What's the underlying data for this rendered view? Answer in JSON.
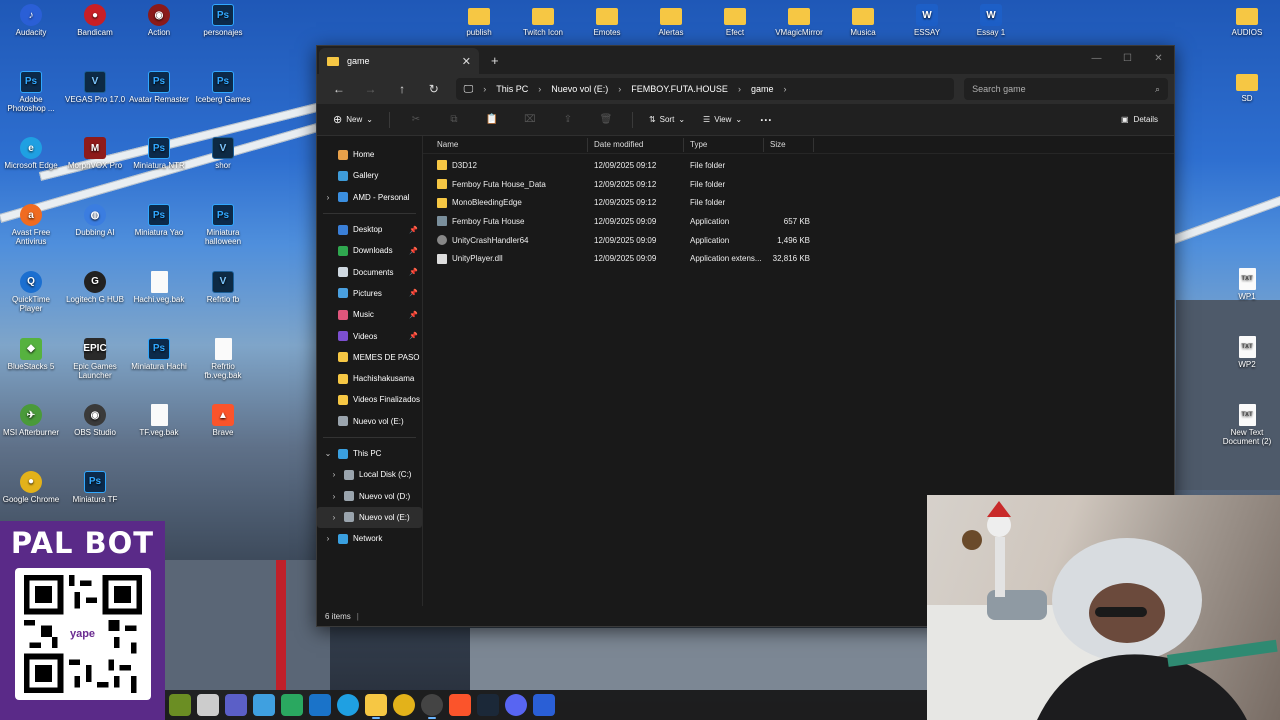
{
  "desktop": {
    "top_left_icons": [
      {
        "label": "Audacity",
        "icon": "audacity-icon",
        "color": "#2a5fd6",
        "style": "round"
      },
      {
        "label": "Bandicam",
        "icon": "bandicam-icon",
        "color": "#c81f26",
        "style": "round"
      },
      {
        "label": "Action",
        "icon": "action-icon",
        "color": "#8b1a1a",
        "style": "round"
      },
      {
        "label": "personajes",
        "icon": "photoshop-icon",
        "color": "#0c2a4a",
        "style": "ps"
      },
      {
        "label": "Adobe Photoshop ...",
        "icon": "photoshop-icon",
        "color": "#0c2a4a",
        "style": "ps"
      },
      {
        "label": "VEGAS Pro 17.0",
        "icon": "vegas-icon",
        "color": "#0d2a44",
        "style": "v"
      },
      {
        "label": "Avatar Remaster",
        "icon": "photoshop-icon",
        "color": "#0c2a4a",
        "style": "ps"
      },
      {
        "label": "Iceberg Games",
        "icon": "photoshop-icon",
        "color": "#0c2a4a",
        "style": "ps"
      },
      {
        "label": "Microsoft Edge",
        "icon": "edge-icon",
        "color": "#1fa0e2",
        "style": "round"
      },
      {
        "label": "MorphVOX Pro",
        "icon": "morphvox-icon",
        "color": "#8e1b1b",
        "style": ""
      },
      {
        "label": "Miniatura NTR",
        "icon": "photoshop-icon",
        "color": "#0c2a4a",
        "style": "ps"
      },
      {
        "label": "shor",
        "icon": "vegas-icon",
        "color": "#0d2a44",
        "style": "v"
      },
      {
        "label": "Avast Free Antivirus",
        "icon": "avast-icon",
        "color": "#f06b21",
        "style": "round"
      },
      {
        "label": "Dubbing AI",
        "icon": "dubbing-icon",
        "color": "#3b7de0",
        "style": "round"
      },
      {
        "label": "Miniatura Yao",
        "icon": "photoshop-icon",
        "color": "#0c2a4a",
        "style": "ps"
      },
      {
        "label": "Miniatura halloween",
        "icon": "photoshop-icon",
        "color": "#0c2a4a",
        "style": "ps"
      },
      {
        "label": "QuickTime Player",
        "icon": "quicktime-icon",
        "color": "#1b6fd0",
        "style": "round"
      },
      {
        "label": "Logitech G HUB",
        "icon": "ghub-icon",
        "color": "#222222",
        "style": "round"
      },
      {
        "label": "Hachi.veg.bak",
        "icon": "file-icon",
        "color": "#fafafa",
        "style": "doc"
      },
      {
        "label": "Refrtio fb",
        "icon": "vegas-icon",
        "color": "#0d2a44",
        "style": "v"
      },
      {
        "label": "BlueStacks 5",
        "icon": "bluestacks-icon",
        "color": "#56b23f",
        "style": ""
      },
      {
        "label": "Epic Games Launcher",
        "icon": "epic-icon",
        "color": "#2a2a2a",
        "style": ""
      },
      {
        "label": "Miniatura Hachi",
        "icon": "photoshop-icon",
        "color": "#0c2a4a",
        "style": "ps"
      },
      {
        "label": "Refrtio fb.veg.bak",
        "icon": "file-icon",
        "color": "#fafafa",
        "style": "doc"
      },
      {
        "label": "MSI Afterburner",
        "icon": "afterburner-icon",
        "color": "#4a9a3a",
        "style": "round"
      },
      {
        "label": "OBS Studio",
        "icon": "obs-icon",
        "color": "#3a3a3a",
        "style": "round"
      },
      {
        "label": "TF.veg.bak",
        "icon": "file-icon",
        "color": "#fafafa",
        "style": "doc"
      },
      {
        "label": "Brave",
        "icon": "brave-icon",
        "color": "#fb542b",
        "style": ""
      },
      {
        "label": "Google Chrome",
        "icon": "chrome-icon",
        "color": "#e3b21a",
        "style": "round"
      },
      {
        "label": "Miniatura TF",
        "icon": "photoshop-icon",
        "color": "#0c2a4a",
        "style": "ps"
      }
    ],
    "top_row_icons": [
      {
        "label": "publish",
        "icon": "folder-icon"
      },
      {
        "label": "Twitch Icon",
        "icon": "folder-icon"
      },
      {
        "label": "Emotes",
        "icon": "folder-icon"
      },
      {
        "label": "Alertas",
        "icon": "folder-icon"
      },
      {
        "label": "Efect",
        "icon": "folder-icon"
      },
      {
        "label": "VMagicMirror",
        "icon": "folder-icon"
      },
      {
        "label": "Musica",
        "icon": "folder-icon"
      },
      {
        "label": "ESSAY",
        "icon": "word-icon"
      },
      {
        "label": "Essay 1",
        "icon": "word-icon"
      }
    ],
    "right_icons": [
      {
        "label": "AUDIOS",
        "icon": "folder-icon"
      },
      {
        "label": "SD",
        "icon": "folder-icon"
      },
      {
        "label": "WP1",
        "icon": "txt-icon"
      },
      {
        "label": "WP2",
        "icon": "txt-icon"
      },
      {
        "label": "New Text Document (2)",
        "icon": "txt-icon"
      }
    ]
  },
  "explorer": {
    "tab_title": "game",
    "new_tab": "+",
    "tab_close": "✕",
    "window_buttons": [
      "—",
      "☐",
      "✕"
    ],
    "breadcrumbs": [
      "This PC",
      "Nuevo vol (E:)",
      "FEMBOY.FUTA.HOUSE",
      "game"
    ],
    "search_placeholder": "Search game",
    "commands": {
      "new": "New",
      "sort": "Sort",
      "view": "View",
      "more": "···",
      "details": "Details"
    },
    "sidebar": [
      {
        "label": "Home",
        "icon": "home-icon",
        "color": "#e8a14a",
        "expand": "",
        "pin": false
      },
      {
        "label": "Gallery",
        "icon": "gallery-icon",
        "color": "#3e9bd8",
        "expand": "",
        "pin": false
      },
      {
        "label": "AMD - Personal",
        "icon": "onedrive-icon",
        "color": "#3b8fe0",
        "expand": "›",
        "pin": false
      },
      {
        "sep": true
      },
      {
        "label": "Desktop",
        "icon": "desktop-icon",
        "color": "#3a7fd8",
        "expand": "",
        "pin": true
      },
      {
        "label": "Downloads",
        "icon": "downloads-icon",
        "color": "#2fa84f",
        "expand": "",
        "pin": true
      },
      {
        "label": "Documents",
        "icon": "documents-icon",
        "color": "#cfd8e0",
        "expand": "",
        "pin": true
      },
      {
        "label": "Pictures",
        "icon": "pictures-icon",
        "color": "#4aa0e0",
        "expand": "",
        "pin": true
      },
      {
        "label": "Music",
        "icon": "music-icon",
        "color": "#e0567c",
        "expand": "",
        "pin": true
      },
      {
        "label": "Videos",
        "icon": "videos-icon",
        "color": "#7c4fd0",
        "expand": "",
        "pin": true
      },
      {
        "label": "MEMES DE PASO",
        "icon": "folder-icon",
        "color": "#f6c744",
        "expand": "",
        "pin": false
      },
      {
        "label": "Hachishakusama",
        "icon": "folder-icon",
        "color": "#f6c744",
        "expand": "",
        "pin": false
      },
      {
        "label": "Videos Finalizados",
        "icon": "folder-icon",
        "color": "#f6c744",
        "expand": "",
        "pin": false
      },
      {
        "label": "Nuevo vol (E:)",
        "icon": "drive-icon",
        "color": "#9aa4ad",
        "expand": "",
        "pin": false
      },
      {
        "sep": true
      },
      {
        "label": "This PC",
        "icon": "thispc-icon",
        "color": "#3aa0e0",
        "expand": "⌄",
        "pin": false
      },
      {
        "label": "Local Disk (C:)",
        "icon": "drive-icon",
        "color": "#9aa4ad",
        "expand": "›",
        "pin": false,
        "indent": true
      },
      {
        "label": "Nuevo vol (D:)",
        "icon": "drive-icon",
        "color": "#9aa4ad",
        "expand": "›",
        "pin": false,
        "indent": true
      },
      {
        "label": "Nuevo vol (E:)",
        "icon": "drive-icon",
        "color": "#9aa4ad",
        "expand": "›",
        "pin": false,
        "indent": true,
        "active": true
      },
      {
        "label": "Network",
        "icon": "network-icon",
        "color": "#3aa0e0",
        "expand": "›",
        "pin": false
      }
    ],
    "columns": [
      "Name",
      "Date modified",
      "Type",
      "Size"
    ],
    "files": [
      {
        "name": "D3D12",
        "date": "12/09/2025 09:12",
        "type": "File folder",
        "size": "",
        "icon": "folder-icon",
        "color": "#f6c744"
      },
      {
        "name": "Femboy Futa House_Data",
        "date": "12/09/2025 09:12",
        "type": "File folder",
        "size": "",
        "icon": "folder-icon",
        "color": "#f6c744"
      },
      {
        "name": "MonoBleedingEdge",
        "date": "12/09/2025 09:12",
        "type": "File folder",
        "size": "",
        "icon": "folder-icon",
        "color": "#f6c744"
      },
      {
        "name": "Femboy Futa House",
        "date": "12/09/2025 09:09",
        "type": "Application",
        "size": "657 KB",
        "icon": "app-icon",
        "color": "#7a8f9c"
      },
      {
        "name": "UnityCrashHandler64",
        "date": "12/09/2025 09:09",
        "type": "Application",
        "size": "1,496 KB",
        "icon": "unity-icon",
        "color": "#888888"
      },
      {
        "name": "UnityPlayer.dll",
        "date": "12/09/2025 09:09",
        "type": "Application extens...",
        "size": "32,816 KB",
        "icon": "dll-icon",
        "color": "#dddddd"
      }
    ],
    "status": "6 items"
  },
  "overlay": {
    "title": "PAL BOT",
    "qr_brand": "yape",
    "bg_color": "#5a2a88"
  },
  "taskbar": {
    "apps": [
      {
        "icon": "minecraft-icon",
        "color": "#6b8e23"
      },
      {
        "icon": "task-view-icon",
        "color": "#cccccc"
      },
      {
        "icon": "teams-icon",
        "color": "#5b5fc7"
      },
      {
        "icon": "copilot-icon",
        "color": "#3fa0e0"
      },
      {
        "icon": "calculator-icon",
        "color": "#2aa860"
      },
      {
        "icon": "outlook-icon",
        "color": "#1a73c9"
      },
      {
        "icon": "edge-icon",
        "color": "#1fa0e2"
      },
      {
        "icon": "file-explorer-icon",
        "color": "#f6c744",
        "active": true
      },
      {
        "icon": "chrome-icon",
        "color": "#e3b21a"
      },
      {
        "icon": "obs-icon",
        "color": "#444444",
        "active": true
      },
      {
        "icon": "brave-icon",
        "color": "#fb542b"
      },
      {
        "icon": "steam-icon",
        "color": "#1b2838"
      },
      {
        "icon": "discord-icon",
        "color": "#5865f2"
      },
      {
        "icon": "audacity-icon",
        "color": "#2a5fd6"
      }
    ]
  }
}
